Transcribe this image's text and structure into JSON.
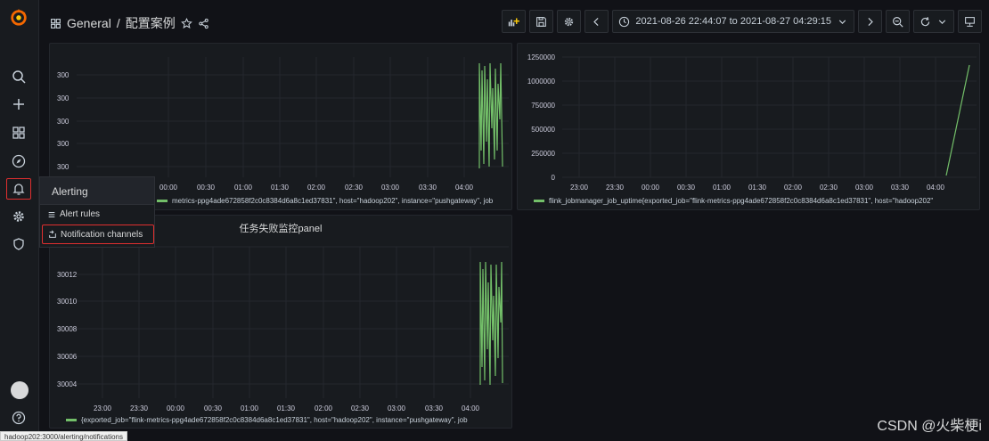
{
  "topbar": {
    "breadcrumb_folder": "General",
    "breadcrumb_sep": "/",
    "dashboard_title": "配置案例",
    "time_range": "2021-08-26 22:44:07 to 2021-08-27 04:29:15"
  },
  "alert_menu": {
    "header": "Alerting",
    "items": [
      {
        "label": "Alert rules"
      },
      {
        "label": "Notification channels"
      }
    ]
  },
  "panels": [
    {
      "title": "",
      "legend": "metrics-ppg4ade672858f2c0c8384d6a8c1ed37831\", host=\"hadoop202\", instance=\"pushgateway\", job",
      "y_ticks": [
        "300",
        "300",
        "300",
        "300",
        "300"
      ],
      "x_ticks": [
        "00:00",
        "00:30",
        "01:00",
        "01:30",
        "02:00",
        "02:30",
        "03:00",
        "03:30",
        "04:00"
      ]
    },
    {
      "title": "",
      "legend": "flink_jobmanager_job_uptime{exported_job=\"flink-metrics-ppg4ade672858f2c0c8384d6a8c1ed37831\", host=\"hadoop202\"",
      "y_ticks": [
        "1250000",
        "1000000",
        "750000",
        "500000",
        "250000",
        "0"
      ],
      "x_ticks": [
        "23:00",
        "23:30",
        "00:00",
        "00:30",
        "01:00",
        "01:30",
        "02:00",
        "02:30",
        "03:00",
        "03:30",
        "04:00"
      ]
    },
    {
      "title": "任务失败监控panel",
      "legend": "{exported_job=\"flink-metrics-ppg4ade672858f2c0c8384d6a8c1ed37831\", host=\"hadoop202\", instance=\"pushgateway\", job",
      "y_ticks": [
        "30012",
        "30010",
        "30008",
        "30006",
        "30004"
      ],
      "x_ticks": [
        "23:00",
        "23:30",
        "00:00",
        "00:30",
        "01:00",
        "01:30",
        "02:00",
        "02:30",
        "03:00",
        "03:30",
        "04:00"
      ]
    }
  ],
  "colors": {
    "series": "#73bf69",
    "highlight": "#e02f2f",
    "accent": "#f46800"
  },
  "watermark": "CSDN @火柴梗i",
  "status_url": "hadoop202:3000/alerting/notifications"
}
